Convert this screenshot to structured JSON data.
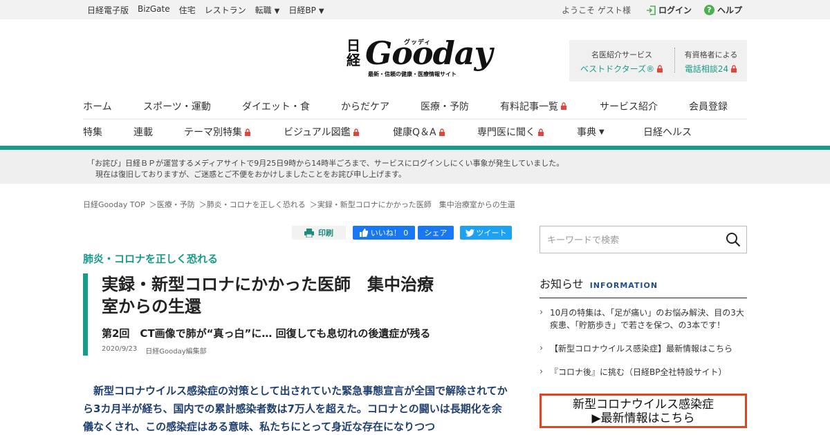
{
  "topbar": {
    "links": [
      "日経電子版",
      "BizGate",
      "住宅",
      "レストラン",
      "転職",
      "日経BP"
    ],
    "welcome": "ようこそ ゲスト様",
    "login": "ログイン",
    "help": "ヘルプ"
  },
  "logo": {
    "nikkei": "日経",
    "gooday": "Gooday",
    "kana": "グッディ",
    "tagline": "最新・信頼の健康・医療情報サイト"
  },
  "services": {
    "col1_caption": "名医紹介サービス",
    "col1_link": "ベストドクターズ®",
    "col2_caption": "有資格者による",
    "col2_link": "電話相談24"
  },
  "nav1": [
    "ホーム",
    "スポーツ・運動",
    "ダイエット・食",
    "からだケア",
    "医療・予防",
    "有料記事一覧",
    "サービス紹介",
    "会員登録"
  ],
  "nav2": [
    "特集",
    "連載",
    "テーマ別特集",
    "ビジュアル図鑑",
    "健康Q＆A",
    "専門医に聞く",
    "事典",
    "日経ヘルス"
  ],
  "notice": {
    "line1": "「お詫び」日経ＢＰが運営するメディアサイトで9月25日9時から14時半ごろまで、サービスにログインしにくい事象が発生していました。",
    "line2": "現在は復旧しておりますが、ご迷惑とご不便をおかけしましたことをお詫び申し上げます。"
  },
  "breadcrumb": [
    "日経Gooday TOP",
    "＞医療・予防",
    "＞肺炎・コロナを正しく恐れる",
    "＞実録・新型コロナにかかった医師　集中治療室からの生還"
  ],
  "share": {
    "print": "印刷",
    "fb_like": "いいね！ 0",
    "fb_share": "シェア",
    "tweet": "ツイート"
  },
  "article": {
    "series": "肺炎・コロナを正しく恐れる",
    "title_line1": "実録・新型コロナにかかった医師　集中治療",
    "title_line2": "室からの生還",
    "subtitle": "第2回　CT画像で肺が“真っ白”に… 回復しても息切れの後遺症が残る",
    "date": "2020/9/23",
    "author": "日経Gooday編集部",
    "lead": "新型コロナウイルス感染症の対策として出されていた緊急事態宣言が全国で解除されてから3カ月半が経ち、国内での累計感染者数は7万人を超えた。コロナとの闘いは長期化を余儀なくされ、この感染症はある意味、私たちにとって身近な存在になりつつ"
  },
  "sidebar": {
    "search_placeholder": "キーワードで検索",
    "info_jp": "お知らせ",
    "info_en": "INFORMATION",
    "news": [
      "10月の特集は、「足が痛い」のお悩み解決、目の3大疾患、「貯筋歩き」で若さを保つ、の3本です！",
      "【新型コロナウイルス感染症】最新情報はこちら",
      "『コロナ後』に挑む（日経BP全社特設サイト）"
    ],
    "banner_line1": "新型コロナウイルス感染症",
    "banner_line2": "▶最新情報はこちら"
  }
}
